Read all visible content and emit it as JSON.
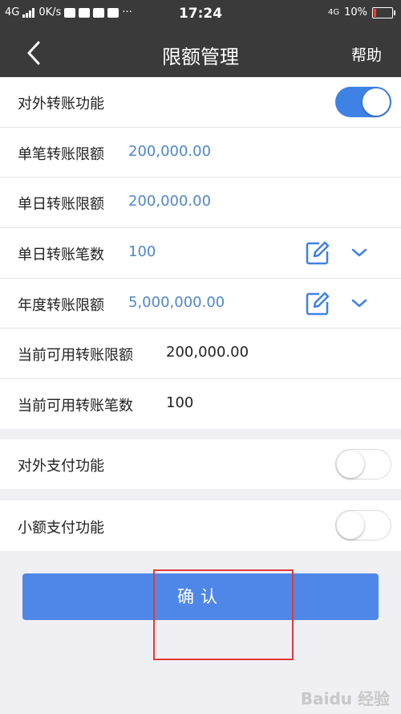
{
  "status_bar": {
    "network_left": "4G",
    "speed": "0K/s",
    "time": "17:24",
    "network_right": "4G",
    "battery": "10%"
  },
  "nav": {
    "title": "限额管理",
    "help": "帮助"
  },
  "rows": {
    "external_transfer": {
      "label": "对外转账功能",
      "enabled": true
    },
    "single_limit": {
      "label": "单笔转账限额",
      "value": "200,000.00"
    },
    "daily_limit": {
      "label": "单日转账限额",
      "value": "200,000.00"
    },
    "daily_count": {
      "label": "单日转账笔数",
      "value": "100"
    },
    "yearly_limit": {
      "label": "年度转账限额",
      "value": "5,000,000.00"
    },
    "available_limit": {
      "label": "当前可用转账限额",
      "value": "200,000.00"
    },
    "available_count": {
      "label": "当前可用转账笔数",
      "value": "100"
    },
    "external_payment": {
      "label": "对外支付功能",
      "enabled": false
    },
    "micro_payment": {
      "label": "小额支付功能",
      "enabled": false
    }
  },
  "confirm_label": "确认",
  "watermark": "Baidu 经验",
  "colors": {
    "accent": "#3f82e6",
    "value_blue": "#4f87c9",
    "header_bg": "#3a3a3a",
    "highlight": "#e53935"
  }
}
